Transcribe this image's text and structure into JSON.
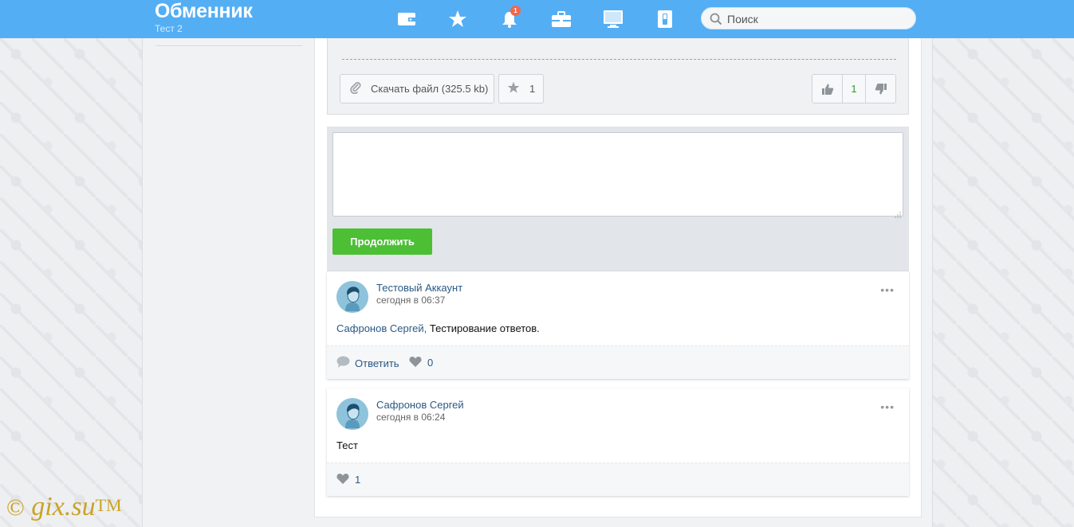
{
  "header": {
    "title": "Обменник",
    "subtitle": "Тест 2",
    "notifications_count": "1",
    "search_placeholder": "Поиск",
    "bar_color": "#54aef4",
    "icons": [
      "wallet-icon",
      "star-icon",
      "bell-icon",
      "briefcase-icon",
      "monitor-icon",
      "switch-icon"
    ]
  },
  "post": {
    "download_label": "Скачать файл (325.5 kb)",
    "favorites_count": "1",
    "rating": "1"
  },
  "comment_form": {
    "text_value": "",
    "submit_label": "Продолжить",
    "submit_color": "#4cbf35"
  },
  "comments": [
    {
      "author": "Тестовый Аккаунт",
      "time": "сегодня в 06:37",
      "reply_to": "Сафронов Сергей,",
      "text": "Тестирование ответов.",
      "reply_label": "Ответить",
      "likes": "0"
    },
    {
      "author": "Сафронов Сергей",
      "time": "сегодня в 06:24",
      "text": "Тест",
      "likes": "1"
    }
  ],
  "watermark": {
    "copyright": "©",
    "site": "gix.su",
    "tm": "TM"
  }
}
